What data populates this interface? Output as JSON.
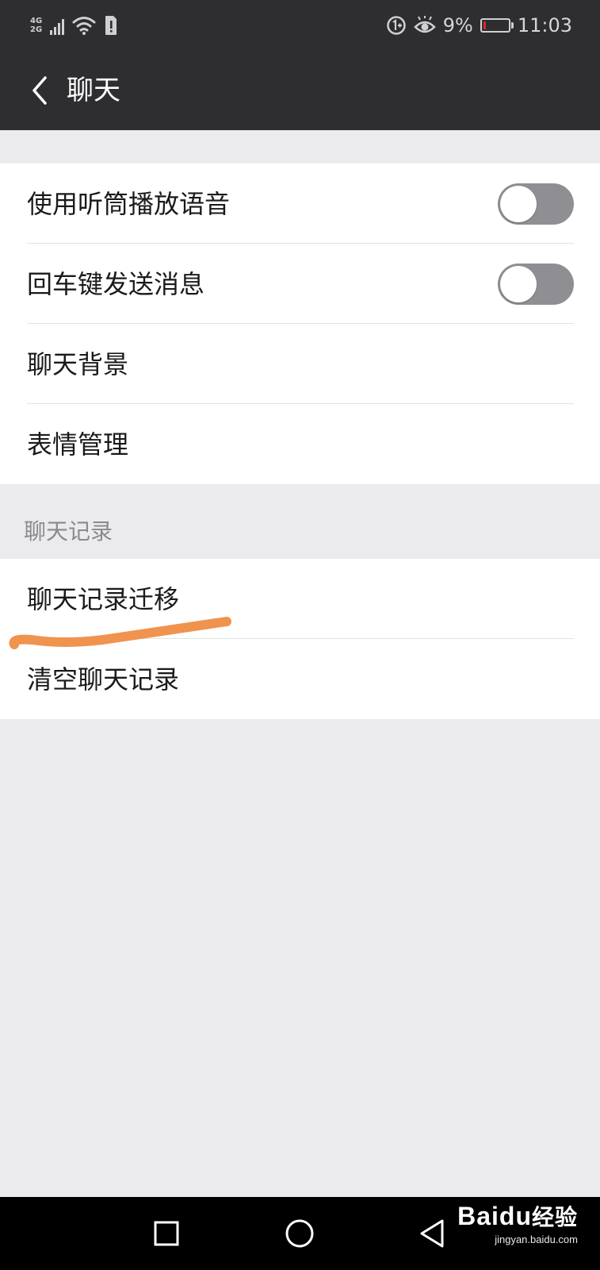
{
  "status_bar": {
    "network_top": "4G",
    "network_bottom": "2G",
    "battery_percent": "9%",
    "battery_level": 0.09,
    "time": "11:03",
    "icons": [
      "signal-icon",
      "wifi-icon",
      "sim-alert-icon",
      "data-saver-icon",
      "eye-comfort-icon",
      "battery-icon"
    ]
  },
  "header": {
    "title": "聊天",
    "back_icon": "chevron-left-icon"
  },
  "settings": {
    "group_1": [
      {
        "label": "使用听筒播放语音",
        "control": "toggle",
        "on": false
      },
      {
        "label": "回车键发送消息",
        "control": "toggle",
        "on": false
      },
      {
        "label": "聊天背景"
      },
      {
        "label": "表情管理"
      }
    ],
    "section_2_header": "聊天记录",
    "group_2": [
      {
        "label": "聊天记录迁移"
      },
      {
        "label": "清空聊天记录"
      }
    ]
  },
  "annotation": {
    "color": "#f0934f"
  },
  "nav_bar": {
    "icons": [
      "recent-apps-icon",
      "home-icon",
      "back-icon"
    ]
  },
  "watermark": {
    "brand": "Bai",
    "brand_du": "du",
    "brand_cn": "经验",
    "url": "jingyan.baidu.com"
  },
  "colors": {
    "header_bg": "#2e2d30",
    "page_bg": "#ebeaed",
    "toggle_off": "#8f8e93"
  }
}
